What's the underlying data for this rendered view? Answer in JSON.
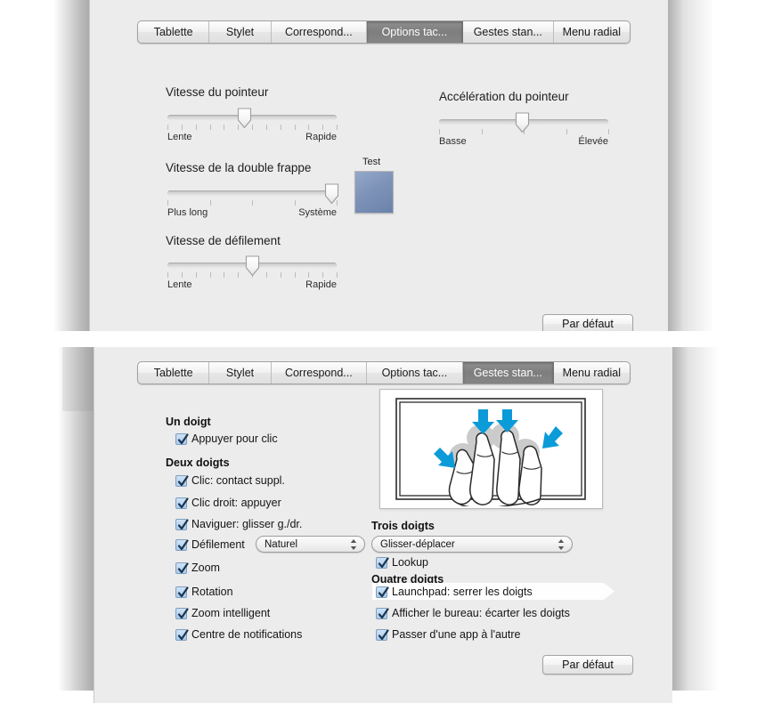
{
  "panels": {
    "top": {
      "tabs": [
        {
          "label": "Tablette",
          "selected": false
        },
        {
          "label": "Stylet",
          "selected": false
        },
        {
          "label": "Correspond...",
          "selected": false
        },
        {
          "label": "Options tac...",
          "selected": true
        },
        {
          "label": "Gestes stan...",
          "selected": false
        },
        {
          "label": "Menu radial",
          "selected": false
        }
      ],
      "sliders": [
        {
          "title": "Vitesse du pointeur",
          "left_label": "Lente",
          "right_label": "Rapide",
          "value_pct": 45,
          "ticks": 13
        },
        {
          "title": "Accélération du pointeur",
          "left_label": "Basse",
          "right_label": "Élevée",
          "value_pct": 49,
          "ticks": 5
        },
        {
          "title": "Vitesse de la double frappe",
          "left_label": "Plus long",
          "right_label": "Système",
          "value_pct": 97,
          "ticks": 5
        },
        {
          "title": "Vitesse de défilement",
          "left_label": "Lente",
          "right_label": "Rapide",
          "value_pct": 50,
          "ticks": 13
        }
      ],
      "test_label": "Test",
      "default_button": "Par défaut"
    },
    "bottom": {
      "tabs": [
        {
          "label": "Tablette",
          "selected": false
        },
        {
          "label": "Stylet",
          "selected": false
        },
        {
          "label": "Correspond...",
          "selected": false
        },
        {
          "label": "Options tac...",
          "selected": false
        },
        {
          "label": "Gestes stan...",
          "selected": true
        },
        {
          "label": "Menu radial",
          "selected": false
        }
      ],
      "groups": {
        "one_finger": {
          "heading": "Un doigt",
          "items": [
            {
              "label": "Appuyer pour clic",
              "checked": true
            }
          ]
        },
        "two_fingers": {
          "heading": "Deux doigts",
          "items": [
            {
              "label": "Clic: contact suppl.",
              "checked": true
            },
            {
              "label": "Clic droit: appuyer",
              "checked": true
            },
            {
              "label": "Naviguer: glisser g./dr.",
              "checked": true
            },
            {
              "label": "Défilement",
              "checked": true,
              "popup": "Naturel"
            },
            {
              "label": "Zoom",
              "checked": true
            },
            {
              "label": "Rotation",
              "checked": true
            },
            {
              "label": "Zoom intelligent",
              "checked": true
            },
            {
              "label": "Centre de notifications",
              "checked": true
            }
          ]
        },
        "three_fingers": {
          "heading": "Trois doigts",
          "popup": "Glisser-déplacer",
          "items": [
            {
              "label": "Lookup",
              "checked": true
            }
          ]
        },
        "four_fingers": {
          "heading": "Quatre doigts",
          "items": [
            {
              "label": "Launchpad: serrer les doigts",
              "checked": true,
              "highlighted": true
            },
            {
              "label": "Afficher le bureau: écarter les doigts",
              "checked": true
            },
            {
              "label": "Passer d'une app à l'autre",
              "checked": true
            }
          ]
        }
      },
      "illustration": "trackpad-four-finger-pinch-icon",
      "default_button": "Par défaut"
    }
  },
  "colors": {
    "window_bg": "#ececec",
    "selected_tab": "#848484",
    "checkbox_blue": "#a9cbec",
    "arrow_blue": "#0b9bd8",
    "test_swatch": "#7e93b8"
  }
}
